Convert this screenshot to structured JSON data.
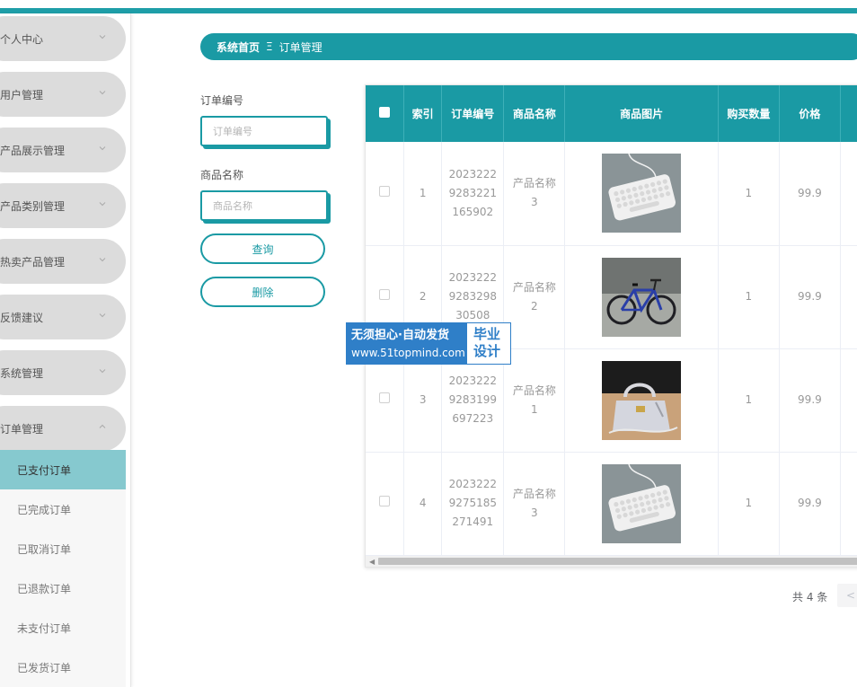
{
  "sidebar": {
    "menu": [
      {
        "label": "个人中心",
        "expanded": false
      },
      {
        "label": "用户管理",
        "expanded": false
      },
      {
        "label": "产品展示管理",
        "expanded": false
      },
      {
        "label": "产品类别管理",
        "expanded": false
      },
      {
        "label": "热卖产品管理",
        "expanded": false
      },
      {
        "label": "反馈建议",
        "expanded": false
      },
      {
        "label": "系统管理",
        "expanded": false
      },
      {
        "label": "订单管理",
        "expanded": true
      }
    ],
    "submenu": [
      {
        "label": "已支付订单",
        "active": true
      },
      {
        "label": "已完成订单",
        "active": false
      },
      {
        "label": "已取消订单",
        "active": false
      },
      {
        "label": "已退款订单",
        "active": false
      },
      {
        "label": "未支付订单",
        "active": false
      },
      {
        "label": "已发货订单",
        "active": false
      }
    ]
  },
  "breadcrumb": {
    "home": "系统首页",
    "separator": "Ξ",
    "current": "订单管理"
  },
  "search": {
    "order_no_label": "订单编号",
    "order_no_placeholder": "订单编号",
    "product_name_label": "商品名称",
    "product_name_placeholder": "商品名称",
    "query_button": "查询",
    "delete_button": "删除"
  },
  "table": {
    "headers": {
      "index": "索引",
      "order_no": "订单编号",
      "product_name": "商品名称",
      "product_image": "商品图片",
      "quantity": "购买数量",
      "price": "价格"
    },
    "rows": [
      {
        "index": "1",
        "order_no": "20232229283221165902",
        "order_no_lines": [
          "2023222",
          "9283221",
          "165902"
        ],
        "product_name_lines": [
          "产品名称",
          "3"
        ],
        "image_icon": "keyboard-image",
        "quantity": "1",
        "price": "99.9"
      },
      {
        "index": "2",
        "order_no": "2023222928329830508",
        "order_no_lines": [
          "2023222",
          "9283298",
          "30508"
        ],
        "product_name_lines": [
          "产品名称",
          "2"
        ],
        "image_icon": "bicycle-image",
        "quantity": "1",
        "price": "99.9"
      },
      {
        "index": "3",
        "order_no": "20232229283199697223",
        "order_no_lines": [
          "2023222",
          "9283199",
          "697223"
        ],
        "product_name_lines": [
          "产品名称",
          "1"
        ],
        "image_icon": "handbag-image",
        "quantity": "1",
        "price": "99.9"
      },
      {
        "index": "4",
        "order_no": "20232229275185271491",
        "order_no_lines": [
          "2023222",
          "9275185",
          "271491"
        ],
        "product_name_lines": [
          "产品名称",
          "3"
        ],
        "image_icon": "keyboard-image",
        "quantity": "1",
        "price": "99.9"
      }
    ]
  },
  "pagination": {
    "total": "共 4 条",
    "prev": "<"
  },
  "watermark": {
    "line1": "无须担心·自动发货",
    "line2": "www.51topmind.com",
    "right1": "毕业",
    "right2": "设计"
  },
  "colors": {
    "accent": "#1a9aa4",
    "active_submenu": "#86c9cf",
    "watermark_blue": "#2f7fc8"
  }
}
